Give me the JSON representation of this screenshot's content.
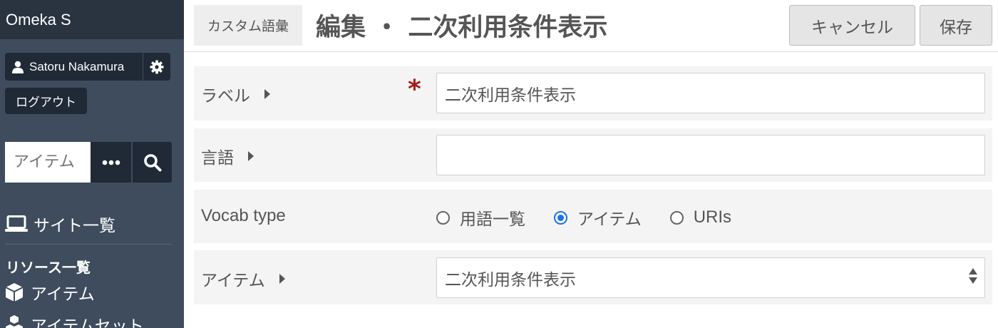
{
  "sidebar": {
    "brand": "Omeka S",
    "user_name": "Satoru Nakamura",
    "logout_label": "ログアウト",
    "search_placeholder": "アイテム",
    "sites_label": "サイト一覧",
    "resources_heading": "リソース一覧",
    "items_label": "アイテム",
    "item_sets_label": "アイテムセット"
  },
  "header": {
    "breadcrumb": "カスタム語彙",
    "title": "編集 ・ 二次利用条件表示",
    "cancel_label": "キャンセル",
    "save_label": "保存"
  },
  "form": {
    "label_field": {
      "label": "ラベル",
      "required_mark": "*",
      "value": "二次利用条件表示"
    },
    "language_field": {
      "label": "言語",
      "value": ""
    },
    "vocab_type": {
      "label": "Vocab type",
      "options": [
        "用語一覧",
        "アイテム",
        "URIs"
      ],
      "selected": "アイテム"
    },
    "item_field": {
      "label": "アイテム",
      "selected_value": "二次利用条件表示"
    }
  },
  "colors": {
    "sidebar_bg": "#3e4c5d",
    "accent": "#1a73e8",
    "required": "#a91919"
  }
}
